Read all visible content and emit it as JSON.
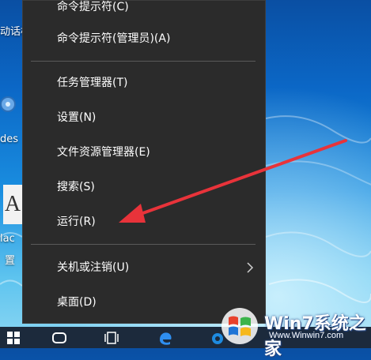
{
  "desktop": {
    "icon_labels": [
      "动话框",
      "des",
      "lac",
      "置"
    ]
  },
  "context_menu": {
    "items": [
      {
        "label": "命令提示符(C)"
      },
      {
        "label": "命令提示符(管理员)(A)"
      },
      {
        "label": "任务管理器(T)"
      },
      {
        "label": "设置(N)"
      },
      {
        "label": "文件资源管理器(E)"
      },
      {
        "label": "搜索(S)"
      },
      {
        "label": "运行(R)"
      },
      {
        "label": "关机或注销(U)",
        "has_submenu": true
      },
      {
        "label": "桌面(D)"
      }
    ],
    "background_color": "#2b2b2b",
    "text_color": "#ffffff"
  },
  "annotation": {
    "arrow_color": "#e8333a",
    "points_to": "运行(R)"
  },
  "taskbar": {
    "buttons": [
      "start-icon",
      "cortana-icon",
      "task-view-icon",
      "edge-icon",
      "store-icon"
    ]
  },
  "watermark": {
    "title": "Win7系统之家",
    "url": "Www.Winwin7.com"
  }
}
